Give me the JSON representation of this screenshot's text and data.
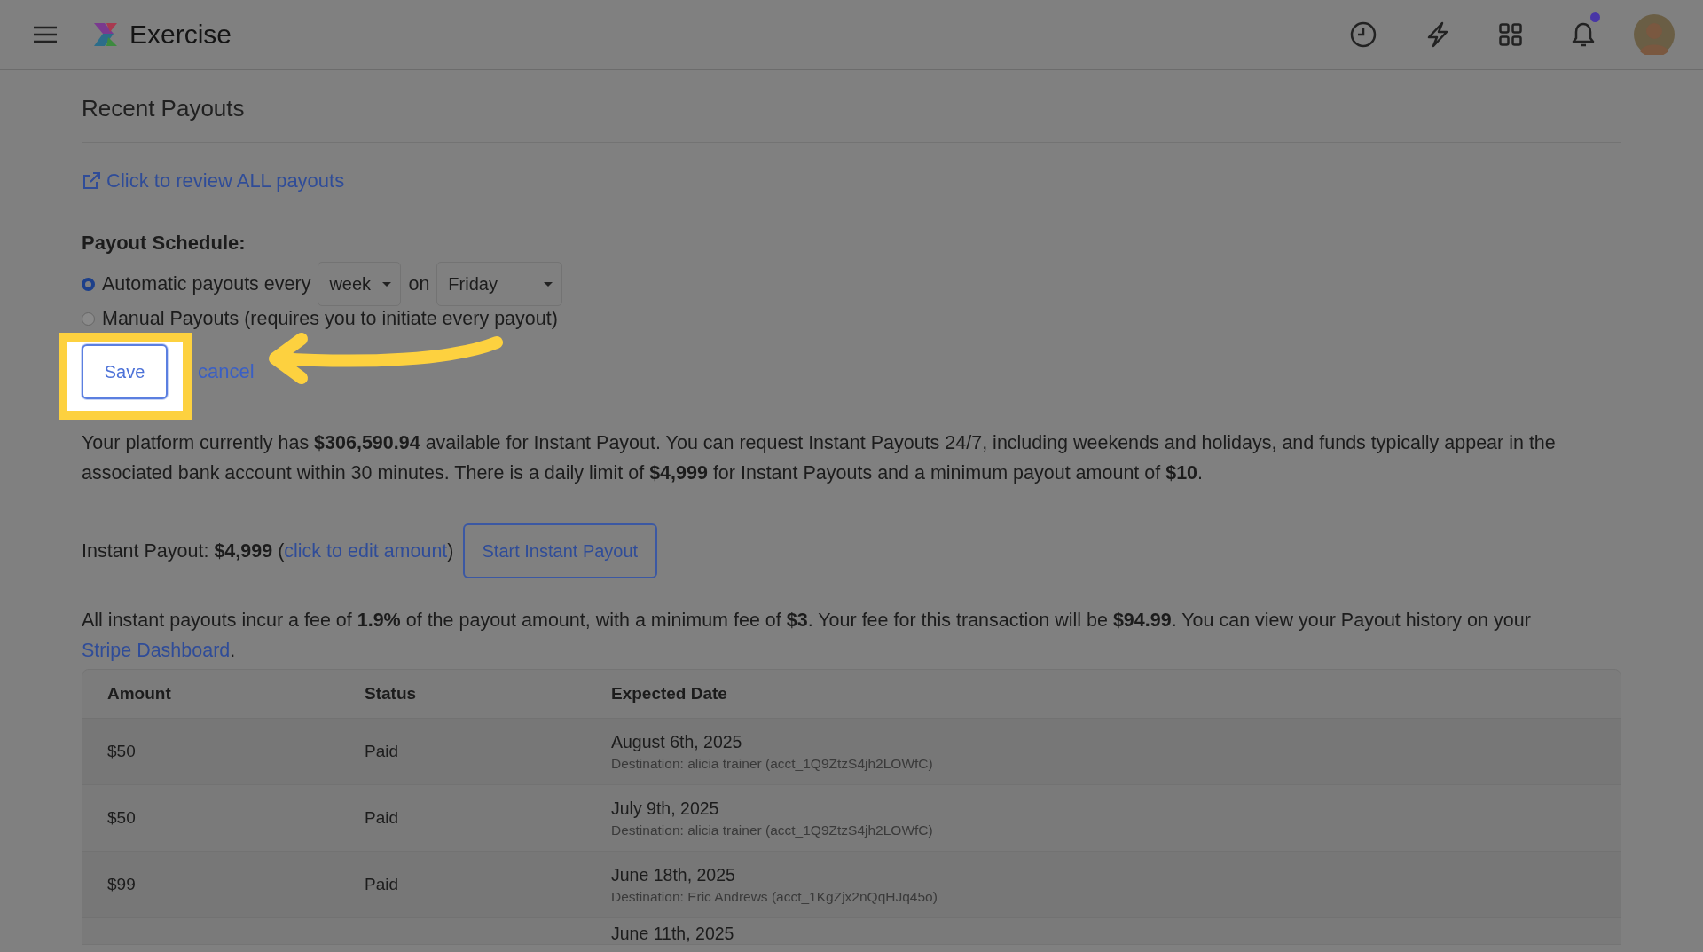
{
  "header": {
    "app_name": "Exercise",
    "has_notification": true
  },
  "title": "Recent Payouts",
  "review_link": "Click to review ALL payouts",
  "schedule": {
    "label": "Payout Schedule:",
    "options": [
      {
        "kind": "automatic",
        "label": "Automatic payouts every",
        "selected": true,
        "interval": "week",
        "joiner": "on",
        "day": "Friday"
      },
      {
        "kind": "manual",
        "label": "Manual Payouts (requires you to initiate every payout)",
        "selected": false
      }
    ],
    "save": "Save",
    "cancel": "cancel"
  },
  "balance_text": "Your platform currently has **$306,590.94** available for Instant Payout. You can request Instant Payouts 24/7, including weekends and holidays, and funds typically appear in the associated bank account within 30 minutes. There is a daily limit of **$4,999** for Instant Payouts and a minimum payout amount of **$10**.",
  "instant": {
    "parts": [
      {
        "kind": "text",
        "text": "Instant Payout: **$4,999** ("
      },
      {
        "kind": "link",
        "text": "click to edit amount"
      },
      {
        "kind": "text",
        "text": ")"
      }
    ],
    "button": "Start Instant Payout"
  },
  "fee_text": [
    {
      "kind": "text",
      "text": "All instant payouts incur a fee of **1.9%** of the payout amount, with a minimum fee of **$3**. Your fee for this transaction will be **$94.99**. You can view your Payout history on your "
    },
    {
      "kind": "link",
      "text": "Stripe Dashboard"
    },
    {
      "kind": "text",
      "text": "."
    }
  ],
  "table": {
    "columns": [
      "Amount",
      "Status",
      "Expected Date"
    ],
    "rows": [
      {
        "amount": "$50",
        "status": "Paid",
        "date": "August 6th, 2025",
        "destination": "Destination: alicia trainer (acct_1Q9ZtzS4jh2LOWfC)"
      },
      {
        "amount": "$50",
        "status": "Paid",
        "date": "July 9th, 2025",
        "destination": "Destination: alicia trainer (acct_1Q9ZtzS4jh2LOWfC)"
      },
      {
        "amount": "$99",
        "status": "Paid",
        "date": "June 18th, 2025",
        "destination": "Destination: Eric Andrews (acct_1KgZjx2nQqHJq45o)"
      },
      {
        "date": "June 11th, 2025"
      }
    ]
  }
}
